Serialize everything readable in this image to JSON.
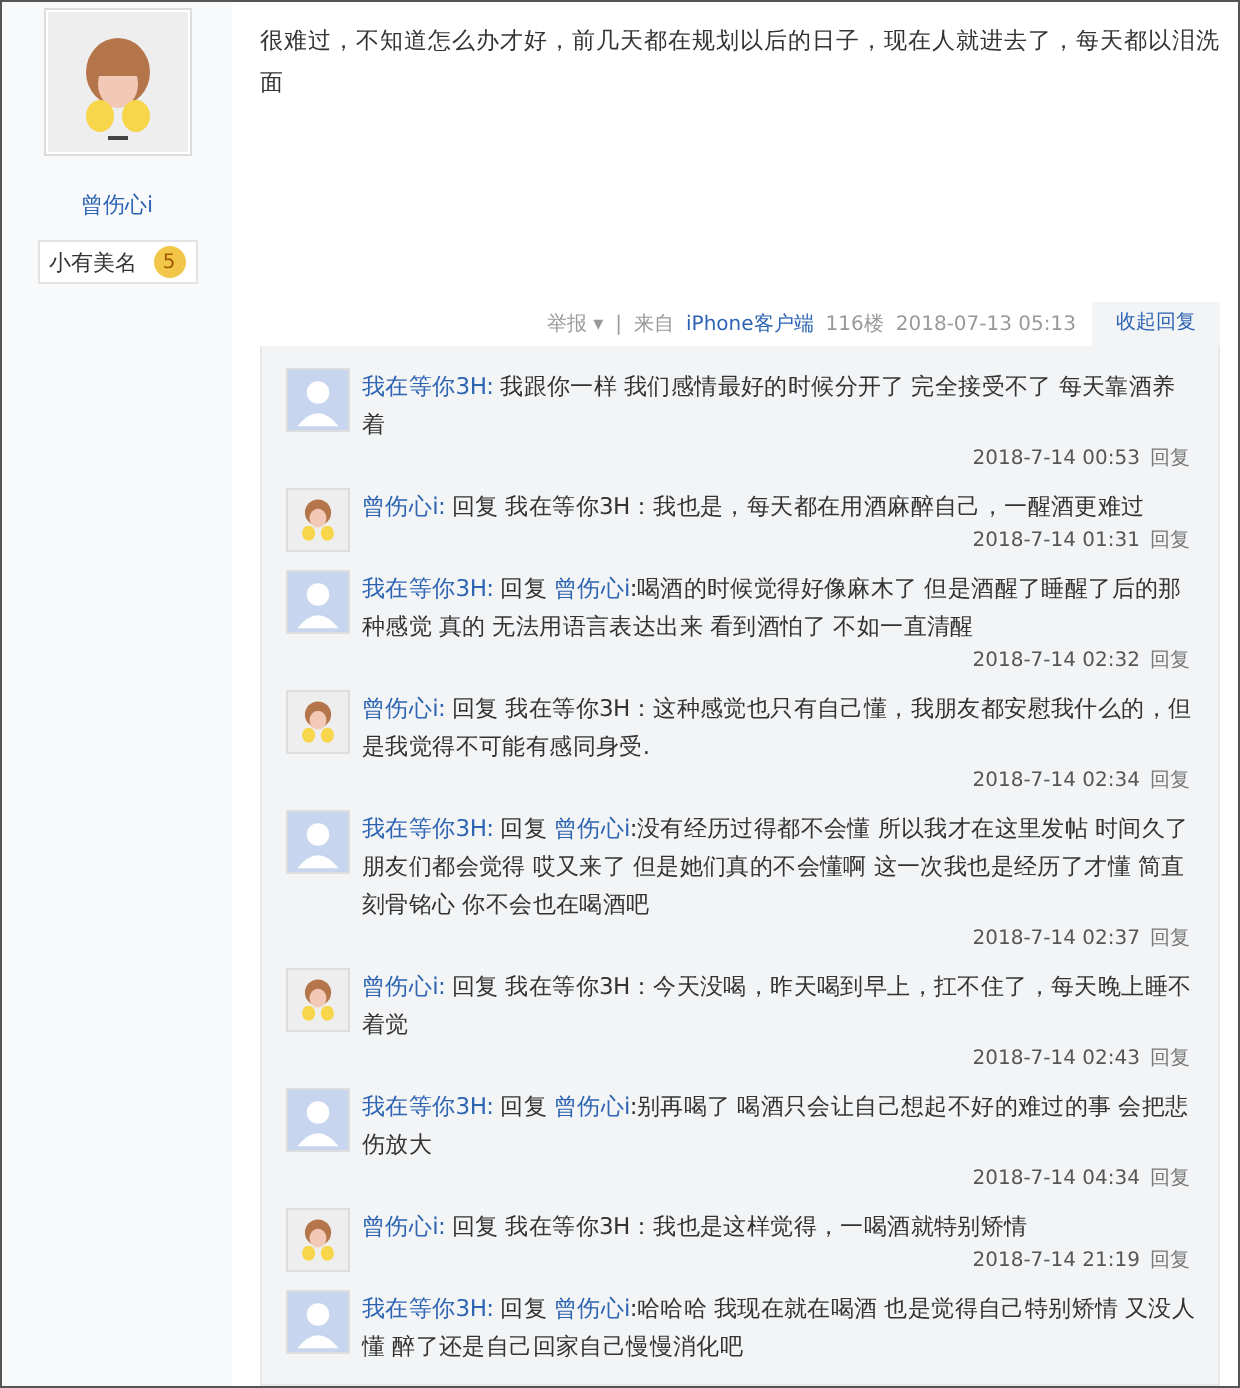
{
  "author": {
    "name": "曾伤心i",
    "badge": "小有美名",
    "level": "5"
  },
  "post": {
    "text": "很难过，不知道怎么办才好，前几天都在规划以后的日子，现在人就进去了，每天都以泪洗面"
  },
  "meta": {
    "report": "举报",
    "report_caret": "▾",
    "separator": "|",
    "source_prefix": "来自",
    "source": "iPhone客户端",
    "floor": "116楼",
    "time": "2018-07-13 05:13",
    "collapse": "收起回复"
  },
  "replies": [
    {
      "author": "我在等你3H:",
      "kind": "default",
      "text": "我跟你一样 我们感情最好的时候分开了 完全接受不了 每天靠酒养着",
      "time": "2018-7-14 00:53",
      "reply": "回复"
    },
    {
      "author": "曾伤心i:",
      "kind": "figure",
      "reply_label": "回复",
      "target": "我在等你3H",
      "target_link": false,
      "text": "：我也是，每天都在用酒麻醉自己，一醒酒更难过",
      "time": "2018-7-14 01:31",
      "reply": "回复"
    },
    {
      "author": "我在等你3H:",
      "kind": "default",
      "reply_label": "回复",
      "target": "曾伤心i",
      "target_link": true,
      "text": ":喝酒的时候觉得好像麻木了 但是酒醒了睡醒了后的那种感觉 真的 无法用语言表达出来 看到酒怕了 不如一直清醒",
      "time": "2018-7-14 02:32",
      "reply": "回复"
    },
    {
      "author": "曾伤心i:",
      "kind": "figure",
      "reply_label": "回复",
      "target": "我在等你3H",
      "target_link": false,
      "text": "：这种感觉也只有自己懂，我朋友都安慰我什么的，但是我觉得不可能有感同身受.",
      "time": "2018-7-14 02:34",
      "reply": "回复"
    },
    {
      "author": "我在等你3H:",
      "kind": "default",
      "reply_label": "回复",
      "target": "曾伤心i",
      "target_link": true,
      "text": ":没有经历过得都不会懂 所以我才在这里发帖 时间久了朋友们都会觉得 哎又来了 但是她们真的不会懂啊 这一次我也是经历了才懂 简直刻骨铭心 你不会也在喝酒吧",
      "time": "2018-7-14 02:37",
      "reply": "回复"
    },
    {
      "author": "曾伤心i:",
      "kind": "figure",
      "reply_label": "回复",
      "target": "我在等你3H",
      "target_link": false,
      "text": "：今天没喝，昨天喝到早上，扛不住了，每天晚上睡不着觉",
      "time": "2018-7-14 02:43",
      "reply": "回复"
    },
    {
      "author": "我在等你3H:",
      "kind": "default",
      "reply_label": "回复",
      "target": "曾伤心i",
      "target_link": true,
      "text": ":别再喝了 喝酒只会让自己想起不好的难过的事 会把悲伤放大",
      "time": "2018-7-14 04:34",
      "reply": "回复"
    },
    {
      "author": "曾伤心i:",
      "kind": "figure",
      "reply_label": "回复",
      "target": "我在等你3H",
      "target_link": false,
      "text": "：我也是这样觉得，一喝酒就特别矫情",
      "time": "2018-7-14 21:19",
      "reply": "回复"
    },
    {
      "author": "我在等你3H:",
      "kind": "default",
      "reply_label": "回复",
      "target": "曾伤心i",
      "target_link": true,
      "text": ":哈哈哈 我现在就在喝酒 也是觉得自己特别矫情 又没人懂 醉了还是自己回家自己慢慢消化吧"
    }
  ]
}
